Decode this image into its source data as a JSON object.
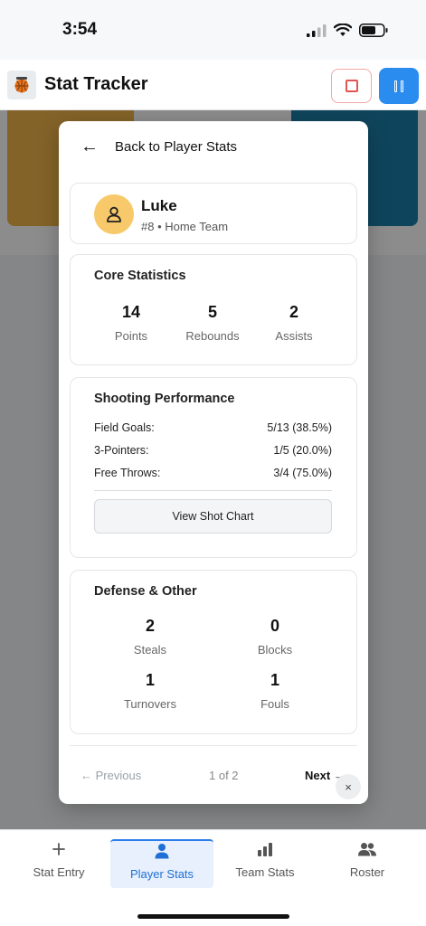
{
  "status_bar": {
    "time": "3:54"
  },
  "header": {
    "title": "Stat Tracker"
  },
  "modal": {
    "back_label": "Back to Player Stats",
    "player": {
      "name": "Luke",
      "meta": "#8 • Home Team"
    },
    "core": {
      "title": "Core Statistics",
      "stats": [
        {
          "value": "14",
          "label": "Points"
        },
        {
          "value": "5",
          "label": "Rebounds"
        },
        {
          "value": "2",
          "label": "Assists"
        }
      ]
    },
    "shooting": {
      "title": "Shooting Performance",
      "rows": [
        {
          "label": "Field Goals:",
          "value": "5/13 (38.5%)"
        },
        {
          "label": "3-Pointers:",
          "value": "1/5 (20.0%)"
        },
        {
          "label": "Free Throws:",
          "value": "3/4 (75.0%)"
        }
      ],
      "button_label": "View Shot Chart"
    },
    "defense": {
      "title": "Defense & Other",
      "stats": [
        {
          "value": "2",
          "label": "Steals"
        },
        {
          "value": "0",
          "label": "Blocks"
        },
        {
          "value": "1",
          "label": "Turnovers"
        },
        {
          "value": "1",
          "label": "Fouls"
        }
      ]
    },
    "pager": {
      "prev": "← Previous",
      "count": "1 of 2",
      "next": "Next →"
    },
    "close": "×"
  },
  "bottom_nav": {
    "items": [
      {
        "label": "Stat Entry",
        "icon": "plus-icon",
        "active": false
      },
      {
        "label": "Player Stats",
        "icon": "person-icon",
        "active": true
      },
      {
        "label": "Team Stats",
        "icon": "bar-chart-icon",
        "active": false
      },
      {
        "label": "Roster",
        "icon": "users-icon",
        "active": false
      }
    ]
  },
  "colors": {
    "accent": "#2b8cf0",
    "avatar": "#f8c96a",
    "stop": "#e05656"
  }
}
